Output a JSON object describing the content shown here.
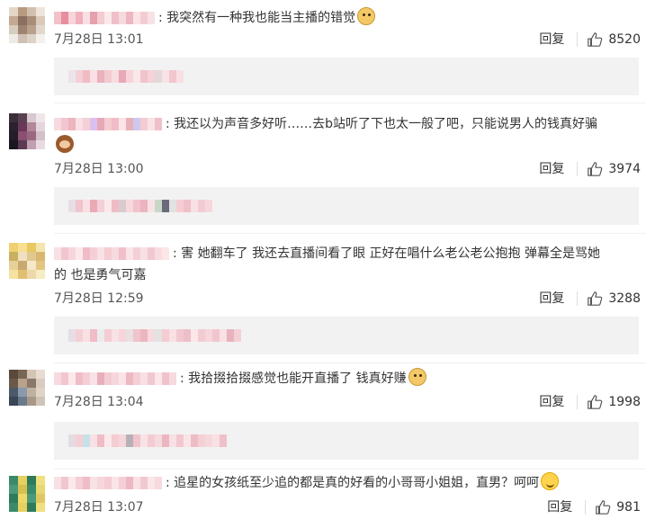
{
  "reply_label": "回复",
  "colors": {
    "accent": "#f2f2f2",
    "text": "#333333",
    "meta": "#555555"
  },
  "comments": [
    {
      "text": "我突然有一种我也能当主播的错觉",
      "emoji": "doge-icon",
      "date": "7月28日 13:01",
      "likes": "8520"
    },
    {
      "text": "我还以为声音多好听……去b站听了下也太一般了吧，只能说男人的钱真好骗",
      "emoji": "monkey-icon",
      "date": "7月28日 13:00",
      "likes": "3974"
    },
    {
      "text": "害 她翻车了 我还去直播间看了眼 正好在唱什么老公老公抱抱  弹幕全是骂她的 也是勇气可嘉",
      "emoji": "",
      "date": "7月28日 12:59",
      "likes": "3288"
    },
    {
      "text": "我拾掇拾掇感觉也能开直播了 钱真好赚",
      "emoji": "doge-icon",
      "date": "7月28日 13:04",
      "likes": "1998"
    },
    {
      "text": "追星的女孩纸至少追的都是真的好看的小哥哥小姐姐，直男？呵呵",
      "emoji": "smile-icon",
      "date": "7月28日 13:07",
      "likes": "981"
    }
  ]
}
